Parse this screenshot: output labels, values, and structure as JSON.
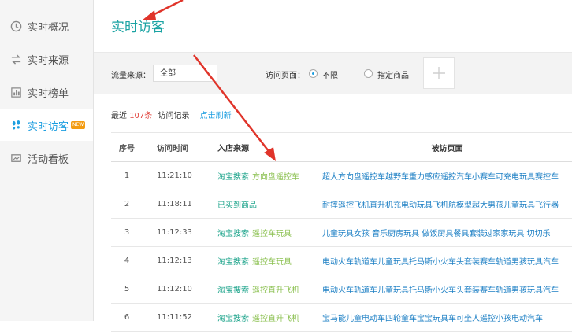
{
  "sidebar": {
    "items": [
      {
        "label": "实时概况",
        "icon": "clock-icon"
      },
      {
        "label": "实时来源",
        "icon": "swap-arrows-icon"
      },
      {
        "label": "实时榜单",
        "icon": "bar-chart-icon"
      },
      {
        "label": "实时访客",
        "icon": "footprints-icon",
        "badge": "NEW"
      },
      {
        "label": "活动看板",
        "icon": "board-icon"
      }
    ]
  },
  "main": {
    "title": "实时访客",
    "filters": {
      "source_label": "流量来源：",
      "source_value": "全部",
      "page_label": "访问页面：",
      "option_unlimited": "不限",
      "option_product": "指定商品"
    },
    "summary": {
      "prefix": "最近",
      "count": "107条",
      "suffix": "访问记录",
      "refresh": "点击刷新"
    },
    "table": {
      "headers": [
        "序号",
        "访问时间",
        "入店来源",
        "被访页面"
      ],
      "rows": [
        {
          "no": "1",
          "time": "11:21:10",
          "src": "淘宝搜索",
          "kw": "方向盘遥控车",
          "page": "超大方向盘遥控车越野车重力感应遥控汽车小赛车可充电玩具赛控车"
        },
        {
          "no": "2",
          "time": "11:18:11",
          "src": "已买到商品",
          "kw": "",
          "page": "耐摔遥控飞机直升机充电动玩具飞机航模型超大男孩儿童玩具飞行器"
        },
        {
          "no": "3",
          "time": "11:12:33",
          "src": "淘宝搜索",
          "kw": "遥控车玩具",
          "page": "儿童玩具女孩 音乐厨房玩具 做饭厨具餐具套装过家家玩具 切切乐"
        },
        {
          "no": "4",
          "time": "11:12:13",
          "src": "淘宝搜索",
          "kw": "遥控车玩具",
          "page": "电动火车轨道车儿童玩具托马斯小火车头套装赛车轨道男孩玩具汽车"
        },
        {
          "no": "5",
          "time": "11:12:10",
          "src": "淘宝搜索",
          "kw": "遥控直升飞机",
          "page": "电动火车轨道车儿童玩具托马斯小火车头套装赛车轨道男孩玩具汽车"
        },
        {
          "no": "6",
          "time": "11:11:52",
          "src": "淘宝搜索",
          "kw": "遥控直升飞机",
          "page": "宝马能儿童电动车四轮童车宝宝玩具车可坐人遥控小孩电动汽车"
        }
      ]
    }
  },
  "colors": {
    "accent": "#1aa3a3",
    "link": "#1c7fc4",
    "count_red": "#e0403a",
    "arrow_red": "#e0342a"
  }
}
